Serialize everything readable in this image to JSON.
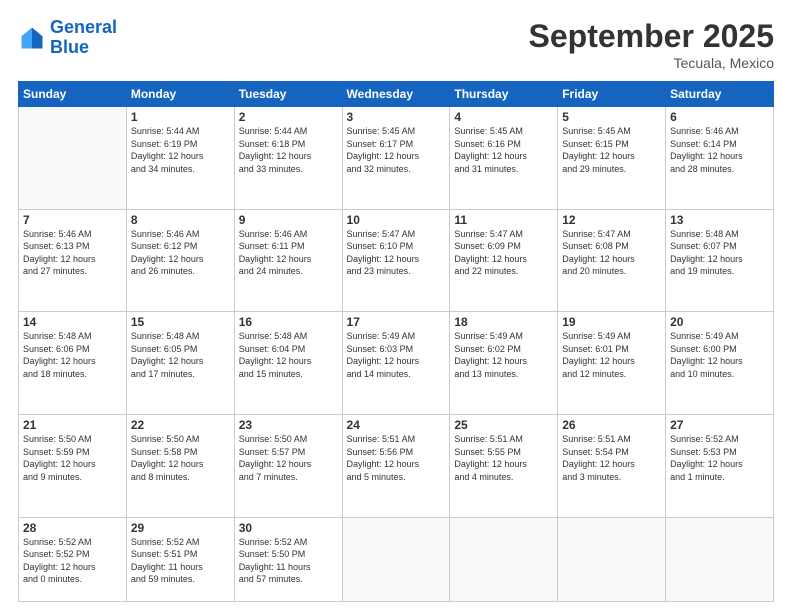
{
  "header": {
    "logo_line1": "General",
    "logo_line2": "Blue",
    "month": "September 2025",
    "location": "Tecuala, Mexico"
  },
  "days_of_week": [
    "Sunday",
    "Monday",
    "Tuesday",
    "Wednesday",
    "Thursday",
    "Friday",
    "Saturday"
  ],
  "weeks": [
    [
      {
        "num": "",
        "info": ""
      },
      {
        "num": "1",
        "info": "Sunrise: 5:44 AM\nSunset: 6:19 PM\nDaylight: 12 hours\nand 34 minutes."
      },
      {
        "num": "2",
        "info": "Sunrise: 5:44 AM\nSunset: 6:18 PM\nDaylight: 12 hours\nand 33 minutes."
      },
      {
        "num": "3",
        "info": "Sunrise: 5:45 AM\nSunset: 6:17 PM\nDaylight: 12 hours\nand 32 minutes."
      },
      {
        "num": "4",
        "info": "Sunrise: 5:45 AM\nSunset: 6:16 PM\nDaylight: 12 hours\nand 31 minutes."
      },
      {
        "num": "5",
        "info": "Sunrise: 5:45 AM\nSunset: 6:15 PM\nDaylight: 12 hours\nand 29 minutes."
      },
      {
        "num": "6",
        "info": "Sunrise: 5:46 AM\nSunset: 6:14 PM\nDaylight: 12 hours\nand 28 minutes."
      }
    ],
    [
      {
        "num": "7",
        "info": "Sunrise: 5:46 AM\nSunset: 6:13 PM\nDaylight: 12 hours\nand 27 minutes."
      },
      {
        "num": "8",
        "info": "Sunrise: 5:46 AM\nSunset: 6:12 PM\nDaylight: 12 hours\nand 26 minutes."
      },
      {
        "num": "9",
        "info": "Sunrise: 5:46 AM\nSunset: 6:11 PM\nDaylight: 12 hours\nand 24 minutes."
      },
      {
        "num": "10",
        "info": "Sunrise: 5:47 AM\nSunset: 6:10 PM\nDaylight: 12 hours\nand 23 minutes."
      },
      {
        "num": "11",
        "info": "Sunrise: 5:47 AM\nSunset: 6:09 PM\nDaylight: 12 hours\nand 22 minutes."
      },
      {
        "num": "12",
        "info": "Sunrise: 5:47 AM\nSunset: 6:08 PM\nDaylight: 12 hours\nand 20 minutes."
      },
      {
        "num": "13",
        "info": "Sunrise: 5:48 AM\nSunset: 6:07 PM\nDaylight: 12 hours\nand 19 minutes."
      }
    ],
    [
      {
        "num": "14",
        "info": "Sunrise: 5:48 AM\nSunset: 6:06 PM\nDaylight: 12 hours\nand 18 minutes."
      },
      {
        "num": "15",
        "info": "Sunrise: 5:48 AM\nSunset: 6:05 PM\nDaylight: 12 hours\nand 17 minutes."
      },
      {
        "num": "16",
        "info": "Sunrise: 5:48 AM\nSunset: 6:04 PM\nDaylight: 12 hours\nand 15 minutes."
      },
      {
        "num": "17",
        "info": "Sunrise: 5:49 AM\nSunset: 6:03 PM\nDaylight: 12 hours\nand 14 minutes."
      },
      {
        "num": "18",
        "info": "Sunrise: 5:49 AM\nSunset: 6:02 PM\nDaylight: 12 hours\nand 13 minutes."
      },
      {
        "num": "19",
        "info": "Sunrise: 5:49 AM\nSunset: 6:01 PM\nDaylight: 12 hours\nand 12 minutes."
      },
      {
        "num": "20",
        "info": "Sunrise: 5:49 AM\nSunset: 6:00 PM\nDaylight: 12 hours\nand 10 minutes."
      }
    ],
    [
      {
        "num": "21",
        "info": "Sunrise: 5:50 AM\nSunset: 5:59 PM\nDaylight: 12 hours\nand 9 minutes."
      },
      {
        "num": "22",
        "info": "Sunrise: 5:50 AM\nSunset: 5:58 PM\nDaylight: 12 hours\nand 8 minutes."
      },
      {
        "num": "23",
        "info": "Sunrise: 5:50 AM\nSunset: 5:57 PM\nDaylight: 12 hours\nand 7 minutes."
      },
      {
        "num": "24",
        "info": "Sunrise: 5:51 AM\nSunset: 5:56 PM\nDaylight: 12 hours\nand 5 minutes."
      },
      {
        "num": "25",
        "info": "Sunrise: 5:51 AM\nSunset: 5:55 PM\nDaylight: 12 hours\nand 4 minutes."
      },
      {
        "num": "26",
        "info": "Sunrise: 5:51 AM\nSunset: 5:54 PM\nDaylight: 12 hours\nand 3 minutes."
      },
      {
        "num": "27",
        "info": "Sunrise: 5:52 AM\nSunset: 5:53 PM\nDaylight: 12 hours\nand 1 minute."
      }
    ],
    [
      {
        "num": "28",
        "info": "Sunrise: 5:52 AM\nSunset: 5:52 PM\nDaylight: 12 hours\nand 0 minutes."
      },
      {
        "num": "29",
        "info": "Sunrise: 5:52 AM\nSunset: 5:51 PM\nDaylight: 11 hours\nand 59 minutes."
      },
      {
        "num": "30",
        "info": "Sunrise: 5:52 AM\nSunset: 5:50 PM\nDaylight: 11 hours\nand 57 minutes."
      },
      {
        "num": "",
        "info": ""
      },
      {
        "num": "",
        "info": ""
      },
      {
        "num": "",
        "info": ""
      },
      {
        "num": "",
        "info": ""
      }
    ]
  ]
}
